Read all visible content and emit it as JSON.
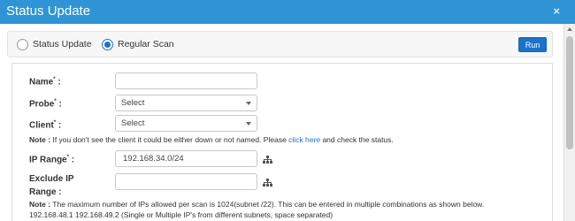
{
  "dialog": {
    "title": "Status Update",
    "close_glyph": "×"
  },
  "mode": {
    "options": [
      {
        "label": "Status Update",
        "selected": false
      },
      {
        "label": "Regular Scan",
        "selected": true
      }
    ],
    "run_label": "Run"
  },
  "form": {
    "name": {
      "label": "Name",
      "required_mark": "*",
      "suffix": " :",
      "value": ""
    },
    "probe": {
      "label": "Probe",
      "required_mark": "*",
      "suffix": " :",
      "value": "Select"
    },
    "client": {
      "label": "Client",
      "required_mark": "*",
      "suffix": " :",
      "value": "Select"
    },
    "client_note": {
      "prefix": "Note :",
      "text_before": " If you don't see the client it could be either down or not named. Please ",
      "link": "click here",
      "text_after": " and check the status."
    },
    "ip_range": {
      "label": "IP Range",
      "required_mark": "*",
      "suffix": " :",
      "value": "192.168.34.0/24",
      "icon": "network-icon"
    },
    "exclude_ip": {
      "label_line1": "Exclude IP",
      "label_line2": "Range :",
      "value": "",
      "icon": "network-icon"
    },
    "ip_note": {
      "prefix": "Note :",
      "text": " The maximum number of IPs allowed per scan is 1024(subnet /22). This can be entered in multiple combinations as shown below."
    },
    "ip_example": "192.168.48.1 192.168.49.2 (Single or Multiple IP's from different subnets, space separated)"
  },
  "colors": {
    "title_bar": "#2e94d6",
    "accent": "#1a73c9"
  }
}
